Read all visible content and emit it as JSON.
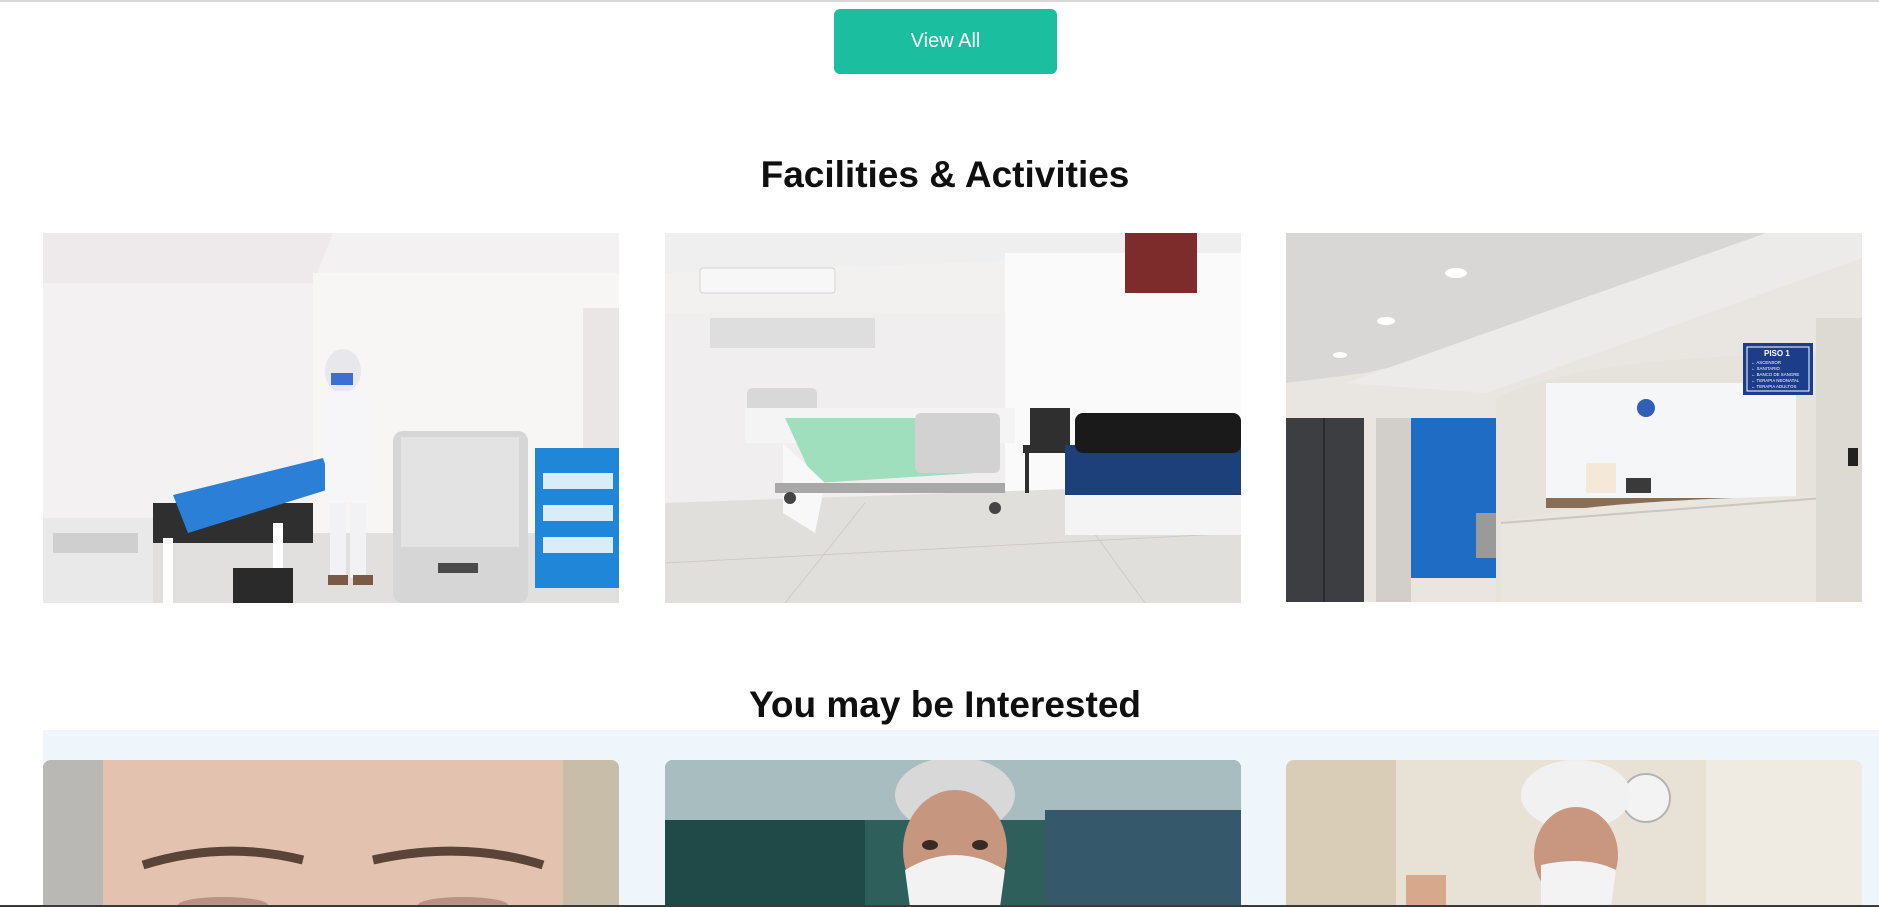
{
  "view_all": {
    "label": "View All",
    "color": "#1bbf9f"
  },
  "facilities": {
    "title": "Facilities & Activities",
    "images": [
      {
        "subject": "examination-room-with-ppe-worker"
      },
      {
        "subject": "patient-room-with-hospital-bed"
      },
      {
        "subject": "hospital-reception-desk",
        "sign_lines": [
          "PISO 1",
          "ASCENSOR",
          "SANITARIO",
          "BANCO DE SANGRE",
          "TERAPIA NEONATAL",
          "TERAPIA ADULTOS"
        ]
      }
    ]
  },
  "interested": {
    "title": "You may be Interested",
    "band_color": "#eef6fc",
    "cards": [
      {
        "subject": "close-up-face-photo"
      },
      {
        "subject": "doctor-with-mask-photo"
      },
      {
        "subject": "surgeon-with-cap-photo"
      }
    ]
  }
}
